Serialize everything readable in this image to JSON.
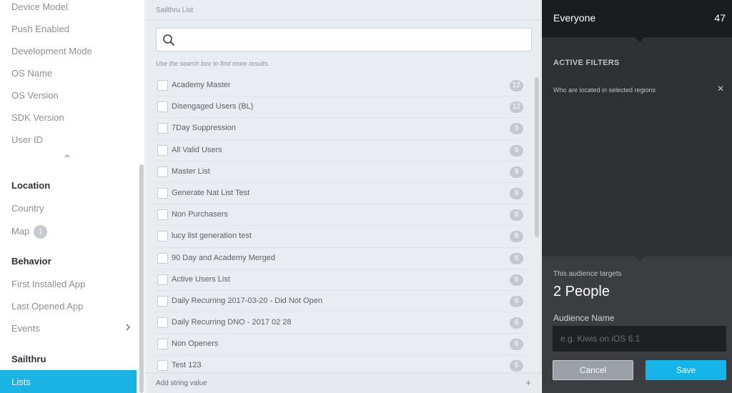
{
  "sidebar": {
    "items_top": [
      {
        "label": "Device Model"
      },
      {
        "label": "Push Enabled"
      },
      {
        "label": "Development Mode"
      },
      {
        "label": "OS Name"
      },
      {
        "label": "OS Version"
      },
      {
        "label": "SDK Version"
      },
      {
        "label": "User ID"
      }
    ],
    "collapse_icon": "chevron-up-icon",
    "location": {
      "heading": "Location",
      "items": [
        {
          "label": "Country"
        },
        {
          "label": "Map",
          "badge": "1"
        }
      ]
    },
    "behavior": {
      "heading": "Behavior",
      "items": [
        {
          "label": "First Installed App"
        },
        {
          "label": "Last Opened App"
        },
        {
          "label": "Events",
          "icon": "chevron-right-icon"
        }
      ]
    },
    "sailthru": {
      "heading": "Sailthru",
      "active_item": "Lists"
    },
    "accent_color": "#1ab1e5"
  },
  "middle": {
    "title": "Sailthru List",
    "search": {
      "value": "",
      "placeholder": "",
      "icon": "search-icon"
    },
    "hint": "Use the search box to find more results.",
    "lists": [
      {
        "label": "Academy Master",
        "count": "12"
      },
      {
        "label": "Disengaged Users (BL)",
        "count": "12"
      },
      {
        "label": "7Day Suppression",
        "count": "9"
      },
      {
        "label": "All Valid Users",
        "count": "9"
      },
      {
        "label": "Master List",
        "count": "9"
      },
      {
        "label": "Generate Nat List Test",
        "count": "8"
      },
      {
        "label": "Non Purchasers",
        "count": "8"
      },
      {
        "label": "lucy list generation test",
        "count": "8"
      },
      {
        "label": "90 Day and Academy Merged",
        "count": "6"
      },
      {
        "label": "Active Users List",
        "count": "6"
      },
      {
        "label": "Daily Recurring 2017-03-20 - Did Not Open",
        "count": "6"
      },
      {
        "label": "Daily Recurring DNO - 2017 02 28",
        "count": "6"
      },
      {
        "label": "Non Openers",
        "count": "6"
      },
      {
        "label": "Test 123",
        "count": "5"
      }
    ],
    "add_bar": {
      "label": "Add string value",
      "icon": "plus-icon",
      "glyph": "+"
    }
  },
  "right": {
    "segment_name": "Everyone",
    "segment_count": "47",
    "active_filters_heading": "ACTIVE FILTERS",
    "filters": [
      {
        "text": "Who are located in selected regions",
        "remove_glyph": "✕"
      }
    ],
    "targets_label": "This audience targets",
    "targets_value": "2 People",
    "audience_name_label": "Audience Name",
    "audience_name_placeholder": "e.g. Kiwis on iOS 6.1",
    "audience_name_value": "",
    "cancel_label": "Cancel",
    "save_label": "Save",
    "save_color": "#13b5ea"
  }
}
